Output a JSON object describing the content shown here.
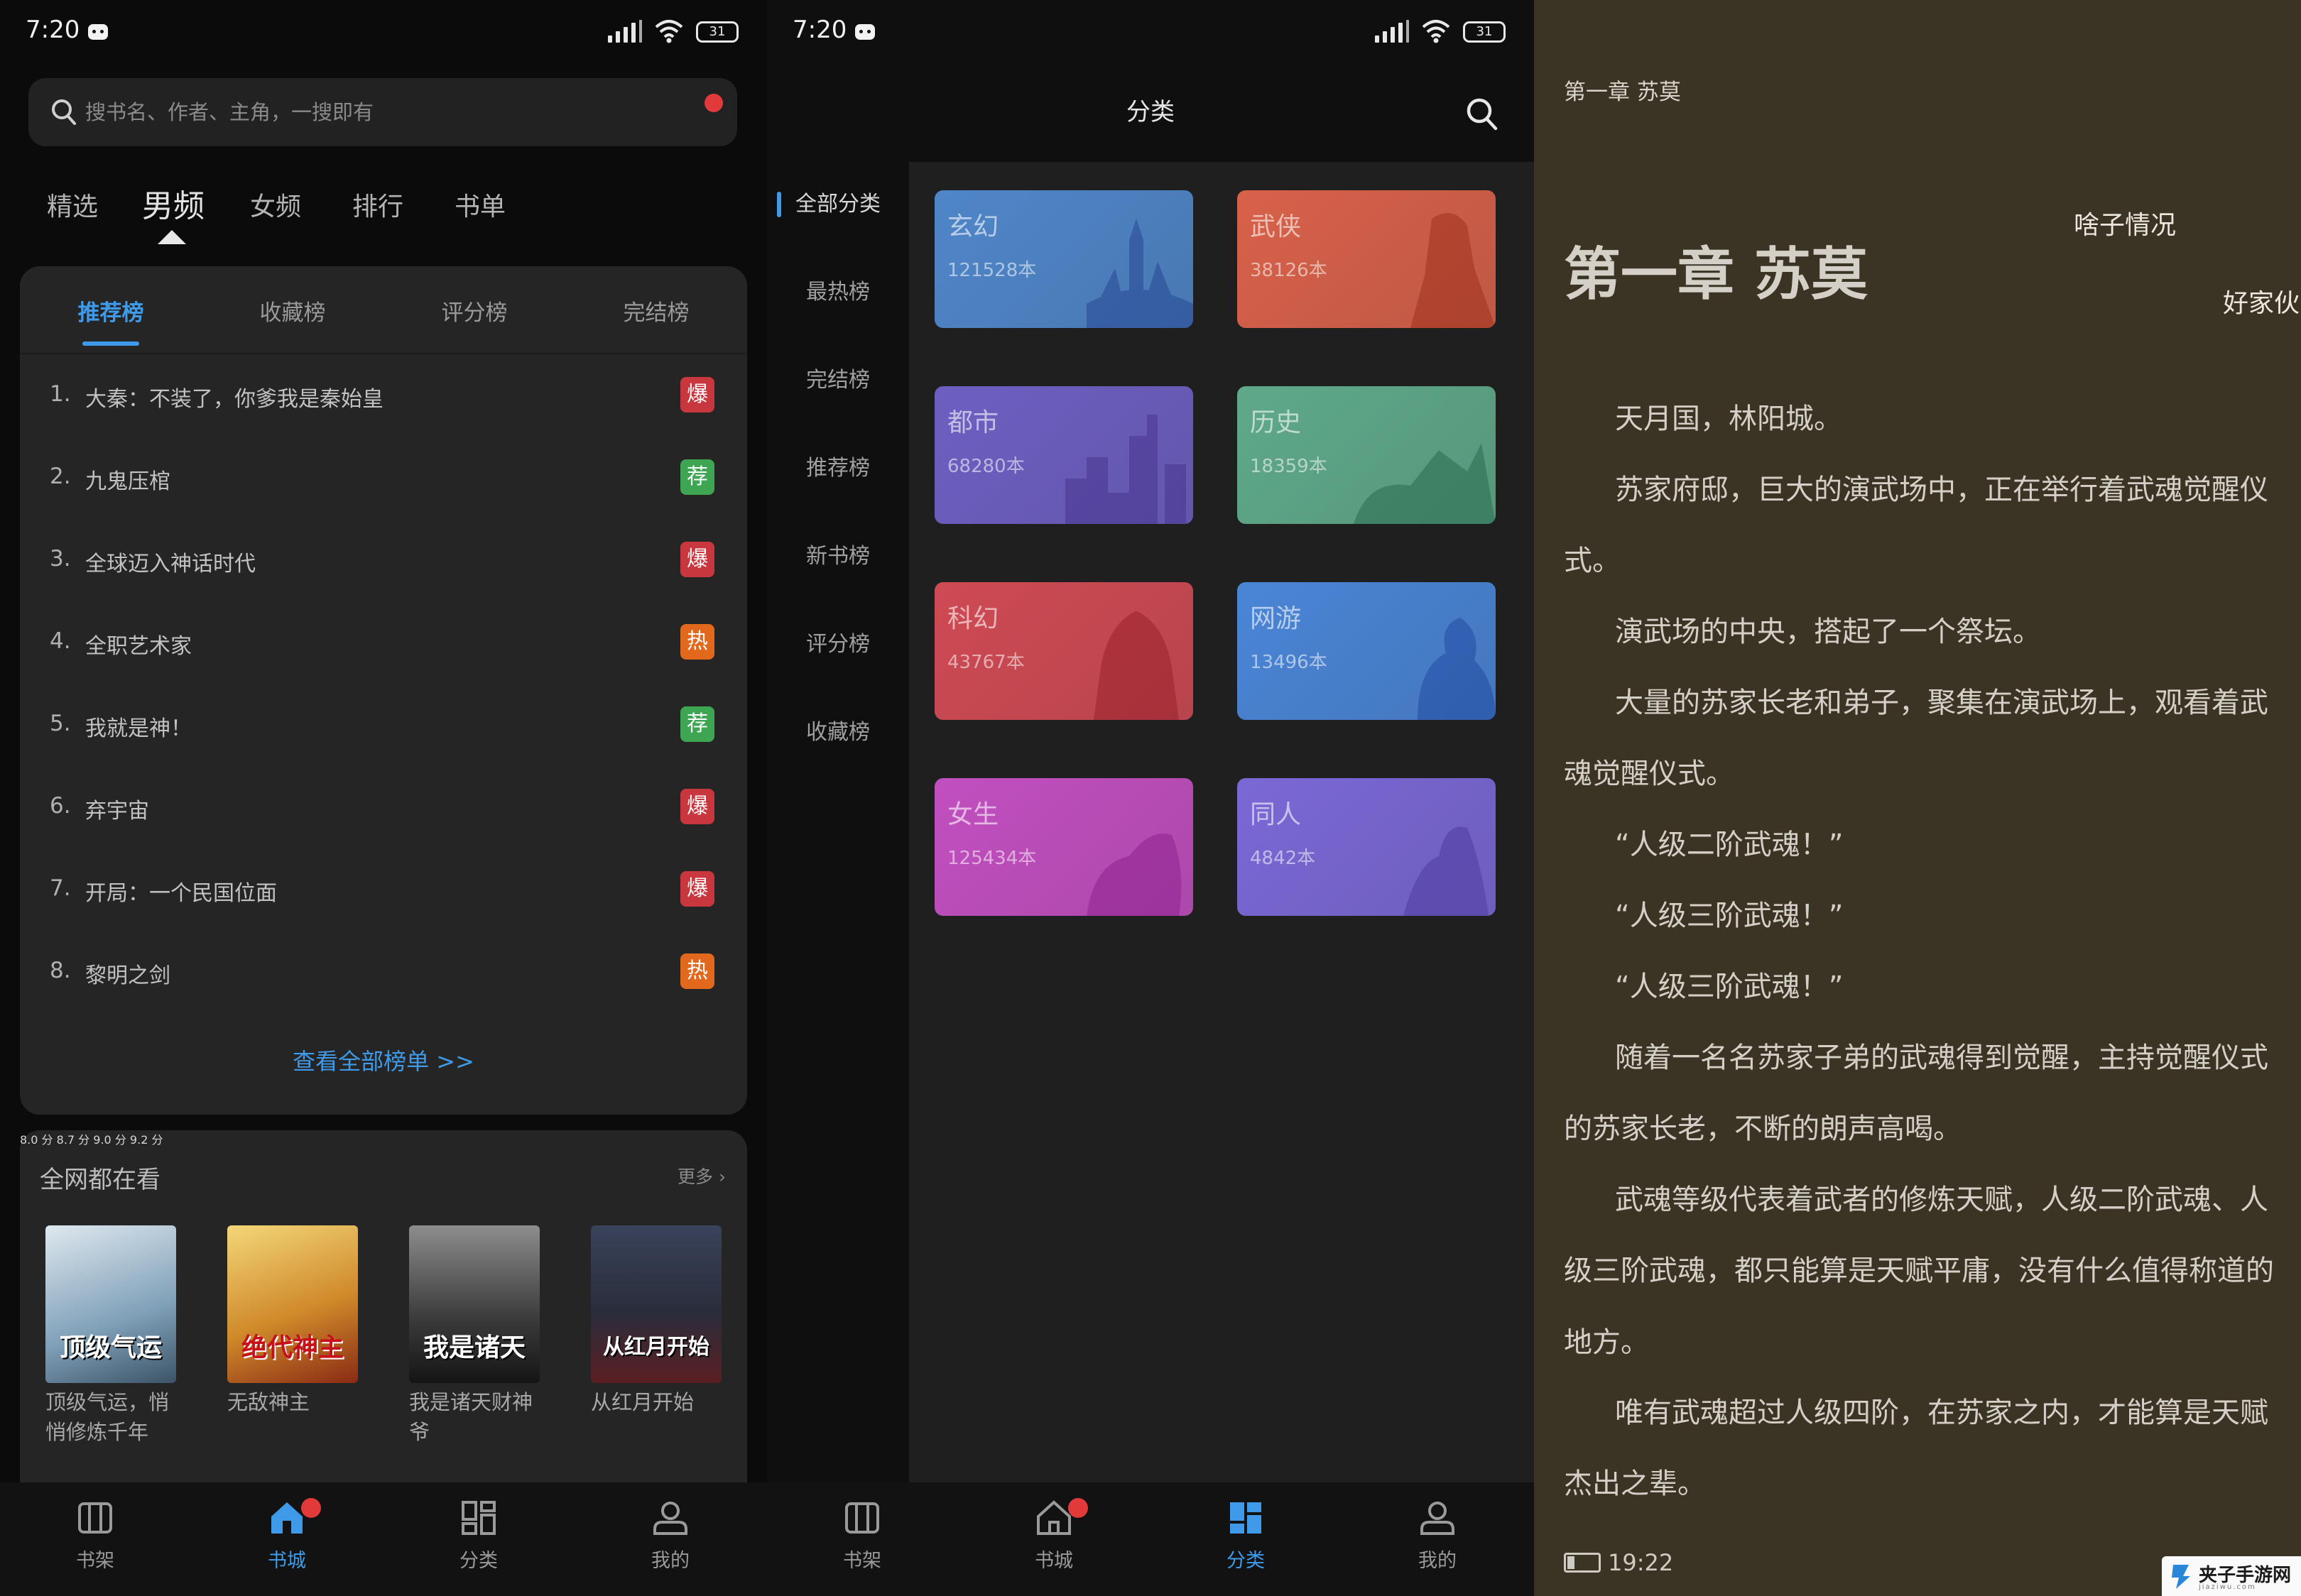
{
  "status": {
    "time": "7:20",
    "battery": "31"
  },
  "panel1": {
    "search_placeholder": "搜书名、作者、主角，一搜即有",
    "tabs": [
      "精选",
      "男频",
      "女频",
      "排行",
      "书单"
    ],
    "active_tab": "男频",
    "rank_tabs": [
      "推荐榜",
      "收藏榜",
      "评分榜",
      "完结榜"
    ],
    "active_rank_tab": "推荐榜",
    "rank_list": [
      {
        "num": "1.",
        "title": "大秦：不装了，你爹我是秦始皇",
        "badge": "爆",
        "color": "#c8373d"
      },
      {
        "num": "2.",
        "title": "九鬼压棺",
        "badge": "荐",
        "color": "#3ea553"
      },
      {
        "num": "3.",
        "title": "全球迈入神话时代",
        "badge": "爆",
        "color": "#c8373d"
      },
      {
        "num": "4.",
        "title": "全职艺术家",
        "badge": "热",
        "color": "#e2681e"
      },
      {
        "num": "5.",
        "title": "我就是神！",
        "badge": "荐",
        "color": "#3ea553"
      },
      {
        "num": "6.",
        "title": "弃宇宙",
        "badge": "爆",
        "color": "#c8373d"
      },
      {
        "num": "7.",
        "title": "开局：一个民国位面",
        "badge": "爆",
        "color": "#c8373d"
      },
      {
        "num": "8.",
        "title": "黎明之剑",
        "badge": "热",
        "color": "#e2681e"
      }
    ],
    "view_all": "查看全部榜单 >>",
    "hot_title": "全网都在看",
    "more": "更多",
    "books": [
      {
        "title": "顶级气运，悄悄修炼千年",
        "score": "8.0 分",
        "cover_text": "顶级气运"
      },
      {
        "title": "无敌神主",
        "score": "8.7 分",
        "cover_text": "绝代神主"
      },
      {
        "title": "我是诸天财神爷",
        "score": "9.0 分",
        "cover_text": "我是诸天"
      },
      {
        "title": "从红月开始",
        "score": "9.2 分",
        "cover_text": "从红月开始"
      }
    ],
    "tabbar": [
      "书架",
      "书城",
      "分类",
      "我的"
    ],
    "active_bar": "书城"
  },
  "panel2": {
    "title": "分类",
    "left_nav": [
      "全部分类",
      "最热榜",
      "完结榜",
      "推荐榜",
      "新书榜",
      "评分榜",
      "收藏榜"
    ],
    "active_nav": "全部分类",
    "categories": [
      {
        "name": "玄幻",
        "count": "121528本",
        "color": "#4f86c9"
      },
      {
        "name": "武侠",
        "count": "38126本",
        "color": "#d8614a"
      },
      {
        "name": "都市",
        "count": "68280本",
        "color": "#6d5fc2"
      },
      {
        "name": "历史",
        "count": "18359本",
        "color": "#5fa98a"
      },
      {
        "name": "科幻",
        "count": "43767本",
        "color": "#cf4a54"
      },
      {
        "name": "网游",
        "count": "13496本",
        "color": "#4a85d6"
      },
      {
        "name": "女生",
        "count": "125434本",
        "color": "#c24fc0"
      },
      {
        "name": "同人",
        "count": "4842本",
        "color": "#7b68d6"
      }
    ],
    "tabbar": [
      "书架",
      "书城",
      "分类",
      "我的"
    ],
    "active_bar": "分类"
  },
  "panel3": {
    "top_title": "第一章 苏莫",
    "chapter_title": "第一章 苏莫",
    "danmu": [
      "啥子情况",
      "好家伙"
    ],
    "paragraphs": [
      "天月国，林阳城。",
      "苏家府邸，巨大的演武场中，正在举行着武魂觉醒仪式。",
      "演武场的中央，搭起了一个祭坛。",
      "大量的苏家长老和弟子，聚集在演武场上，观看着武魂觉醒仪式。",
      "“人级二阶武魂！”",
      "“人级三阶武魂！”",
      "“人级三阶武魂！”",
      "随着一名名苏家子弟的武魂得到觉醒，主持觉醒仪式的苏家长老，不断的朗声高喝。",
      "武魂等级代表着武者的修炼天赋，人级二阶武魂、人级三阶武魂，都只能算是天赋平庸，没有什么值得称道的地方。",
      "唯有武魂超过人级四阶，在苏家之内，才能算是天赋杰出之辈。"
    ],
    "clock": "19:22"
  },
  "watermark": {
    "title": "夹子手游网",
    "sub": "jiaziwu.com"
  }
}
